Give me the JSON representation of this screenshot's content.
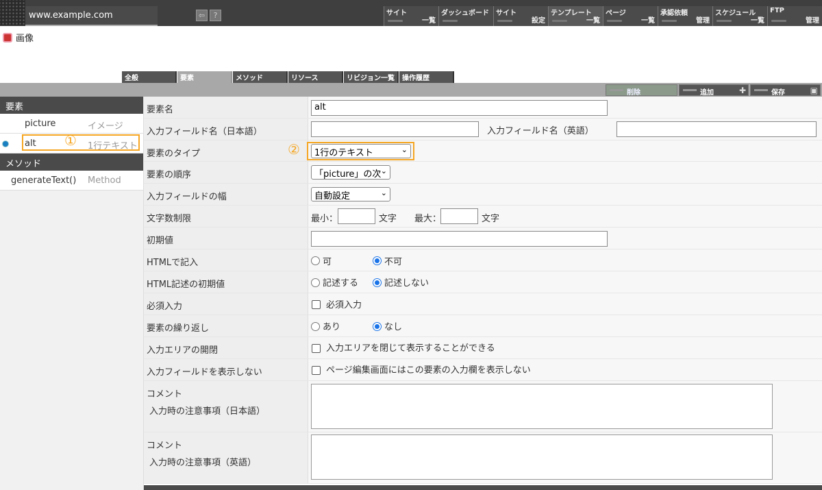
{
  "topbar": {
    "domain": "www.example.com",
    "back_icon": "back-arrow-icon",
    "help_label": "?",
    "nav": [
      {
        "title": "サイト",
        "sub": "一覧"
      },
      {
        "title": "ダッシュボード",
        "sub": ""
      },
      {
        "title": "サイト",
        "sub": "設定"
      },
      {
        "title": "テンプレート",
        "sub": "一覧"
      },
      {
        "title": "ページ",
        "sub": "一覧"
      },
      {
        "title": "承認依頼",
        "sub": "管理"
      },
      {
        "title": "スケジュール",
        "sub": "一覧"
      },
      {
        "title": "FTP",
        "sub": "管理"
      }
    ]
  },
  "page": {
    "title": "画像",
    "icon": "image-icon"
  },
  "tabs": [
    "全般",
    "要素",
    "メソッド",
    "リソース",
    "リビジョン一覧",
    "操作履歴"
  ],
  "active_tab": "要素",
  "actions": {
    "delete": "削除",
    "add": "追加",
    "save": "保存"
  },
  "sidebar": {
    "elements_header": "要素",
    "elements": [
      {
        "name": "picture",
        "type": "イメージ"
      },
      {
        "name": "alt",
        "type": "1行テキスト"
      }
    ],
    "methods_header": "メソッド",
    "methods": [
      {
        "name": "generateText()",
        "type": "Method"
      }
    ],
    "marker1": "①"
  },
  "form": {
    "element_name": {
      "label": "要素名",
      "value": "alt"
    },
    "field_name": {
      "label_ja": "入力フィールド名（日本語）",
      "label_en": "入力フィールド名（英語）",
      "value_ja": "",
      "value_en": ""
    },
    "element_type": {
      "label": "要素のタイプ",
      "selected": "1行のテキスト",
      "marker": "②"
    },
    "element_order": {
      "label": "要素の順序",
      "selected": "「picture」の次"
    },
    "field_width": {
      "label": "入力フィールドの幅",
      "selected": "自動設定"
    },
    "char_limit": {
      "label": "文字数制限",
      "min_label": "最小：",
      "max_label": "最大：",
      "unit": "文字",
      "min": "",
      "max": ""
    },
    "initial_value": {
      "label": "初期値",
      "value": ""
    },
    "html_input": {
      "label": "HTMLで記入",
      "options": [
        "可",
        "不可"
      ],
      "selected": "不可"
    },
    "html_initial": {
      "label": "HTML記述の初期値",
      "options": [
        "記述する",
        "記述しない"
      ],
      "selected": "記述しない"
    },
    "required": {
      "label": "必須入力",
      "checkbox_label": "必須入力",
      "checked": false
    },
    "repeat": {
      "label": "要素の繰り返し",
      "options": [
        "あり",
        "なし"
      ],
      "selected": "なし"
    },
    "collapse": {
      "label": "入力エリアの開閉",
      "checkbox_label": "入力エリアを閉じて表示することができる",
      "checked": false
    },
    "hide_field": {
      "label": "入力フィールドを表示しない",
      "checkbox_label": "ページ編集画面にはこの要素の入力欄を表示しない",
      "checked": false
    },
    "comment_ja": {
      "label1": "コメント",
      "label2": "入力時の注意事項（日本語）",
      "value": ""
    },
    "comment_en": {
      "label1": "コメント",
      "label2": "入力時の注意事項（英語）",
      "value": ""
    }
  }
}
